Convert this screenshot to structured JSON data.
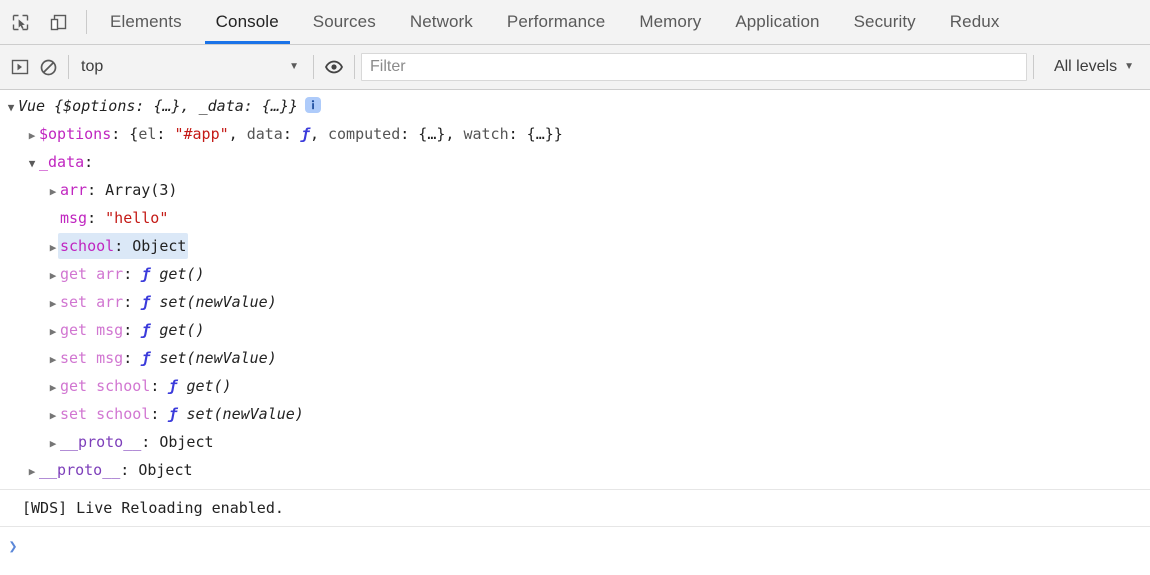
{
  "toolbar": {
    "inspect_icon": "inspect-element-icon",
    "device_icon": "device-toolbar-icon",
    "tabs": [
      {
        "label": "Elements",
        "active": false
      },
      {
        "label": "Console",
        "active": true
      },
      {
        "label": "Sources",
        "active": false
      },
      {
        "label": "Network",
        "active": false
      },
      {
        "label": "Performance",
        "active": false
      },
      {
        "label": "Memory",
        "active": false
      },
      {
        "label": "Application",
        "active": false
      },
      {
        "label": "Security",
        "active": false
      },
      {
        "label": "Redux",
        "active": false
      }
    ]
  },
  "filterbar": {
    "sidebar_icon": "console-sidebar-icon",
    "clear_icon": "clear-console-icon",
    "context": "top",
    "context_caret": "▼",
    "eye_icon": "live-expression-eye-icon",
    "filter_placeholder": "Filter",
    "filter_value": "",
    "levels_label": "All levels",
    "levels_caret": "▼"
  },
  "console": {
    "arrow_open": "▼",
    "arrow_closed": "▶",
    "entries": [
      {
        "indent": 0,
        "arrow": "open",
        "parts": [
          {
            "text": "Vue ",
            "cls": "t-ctor"
          },
          {
            "text": "{$options: {…}, _data: {…}}",
            "cls": "t-ctor"
          }
        ],
        "badge": "info-badge"
      },
      {
        "indent": 1,
        "arrow": "closed",
        "parts": [
          {
            "text": "$options",
            "cls": "t-key"
          },
          {
            "text": ": {",
            "cls": "t-punct"
          },
          {
            "text": "el",
            "cls": "t-subkey"
          },
          {
            "text": ": ",
            "cls": "t-punct"
          },
          {
            "text": "\"#app\"",
            "cls": "t-str"
          },
          {
            "text": ", ",
            "cls": "t-punct"
          },
          {
            "text": "data",
            "cls": "t-subkey"
          },
          {
            "text": ": ",
            "cls": "t-punct"
          },
          {
            "text": "ƒ",
            "cls": "t-fnsym"
          },
          {
            "text": ", ",
            "cls": "t-punct"
          },
          {
            "text": "computed",
            "cls": "t-subkey"
          },
          {
            "text": ": {…}, ",
            "cls": "t-punct"
          },
          {
            "text": "watch",
            "cls": "t-subkey"
          },
          {
            "text": ": {…}}",
            "cls": "t-punct"
          }
        ]
      },
      {
        "indent": 1,
        "arrow": "open",
        "parts": [
          {
            "text": "_data",
            "cls": "t-key"
          },
          {
            "text": ":",
            "cls": "t-punct"
          }
        ]
      },
      {
        "indent": 2,
        "arrow": "closed",
        "parts": [
          {
            "text": "arr",
            "cls": "t-key"
          },
          {
            "text": ": ",
            "cls": "t-punct"
          },
          {
            "text": "Array(3)",
            "cls": "t-obj"
          }
        ]
      },
      {
        "indent": 2,
        "arrow": "none",
        "parts": [
          {
            "text": "msg",
            "cls": "t-key"
          },
          {
            "text": ": ",
            "cls": "t-punct"
          },
          {
            "text": "\"hello\"",
            "cls": "t-str"
          }
        ]
      },
      {
        "indent": 2,
        "arrow": "closed",
        "highlight": true,
        "parts": [
          {
            "text": "school",
            "cls": "t-key"
          },
          {
            "text": ": ",
            "cls": "t-punct"
          },
          {
            "text": "Object",
            "cls": "t-obj"
          }
        ]
      },
      {
        "indent": 2,
        "arrow": "closed",
        "parts": [
          {
            "text": "get arr",
            "cls": "t-key-a"
          },
          {
            "text": ": ",
            "cls": "t-punct"
          },
          {
            "text": "ƒ ",
            "cls": "t-fnsym"
          },
          {
            "text": "get()",
            "cls": "t-fn"
          }
        ]
      },
      {
        "indent": 2,
        "arrow": "closed",
        "parts": [
          {
            "text": "set arr",
            "cls": "t-key-a"
          },
          {
            "text": ": ",
            "cls": "t-punct"
          },
          {
            "text": "ƒ ",
            "cls": "t-fnsym"
          },
          {
            "text": "set(newValue)",
            "cls": "t-fn"
          }
        ]
      },
      {
        "indent": 2,
        "arrow": "closed",
        "parts": [
          {
            "text": "get msg",
            "cls": "t-key-a"
          },
          {
            "text": ": ",
            "cls": "t-punct"
          },
          {
            "text": "ƒ ",
            "cls": "t-fnsym"
          },
          {
            "text": "get()",
            "cls": "t-fn"
          }
        ]
      },
      {
        "indent": 2,
        "arrow": "closed",
        "parts": [
          {
            "text": "set msg",
            "cls": "t-key-a"
          },
          {
            "text": ": ",
            "cls": "t-punct"
          },
          {
            "text": "ƒ ",
            "cls": "t-fnsym"
          },
          {
            "text": "set(newValue)",
            "cls": "t-fn"
          }
        ]
      },
      {
        "indent": 2,
        "arrow": "closed",
        "parts": [
          {
            "text": "get school",
            "cls": "t-key-a"
          },
          {
            "text": ": ",
            "cls": "t-punct"
          },
          {
            "text": "ƒ ",
            "cls": "t-fnsym"
          },
          {
            "text": "get()",
            "cls": "t-fn"
          }
        ]
      },
      {
        "indent": 2,
        "arrow": "closed",
        "parts": [
          {
            "text": "set school",
            "cls": "t-key-a"
          },
          {
            "text": ": ",
            "cls": "t-punct"
          },
          {
            "text": "ƒ ",
            "cls": "t-fnsym"
          },
          {
            "text": "set(newValue)",
            "cls": "t-fn"
          }
        ]
      },
      {
        "indent": 2,
        "arrow": "closed",
        "parts": [
          {
            "text": "__proto__",
            "cls": "t-proto"
          },
          {
            "text": ": ",
            "cls": "t-punct"
          },
          {
            "text": "Object",
            "cls": "t-obj"
          }
        ]
      },
      {
        "indent": 1,
        "arrow": "closed",
        "parts": [
          {
            "text": "__proto__",
            "cls": "t-proto"
          },
          {
            "text": ": ",
            "cls": "t-punct"
          },
          {
            "text": "Object",
            "cls": "t-obj"
          }
        ]
      }
    ],
    "log_line": "[WDS] Live Reloading enabled.",
    "prompt_chevron": "❯",
    "prompt_value": ""
  }
}
